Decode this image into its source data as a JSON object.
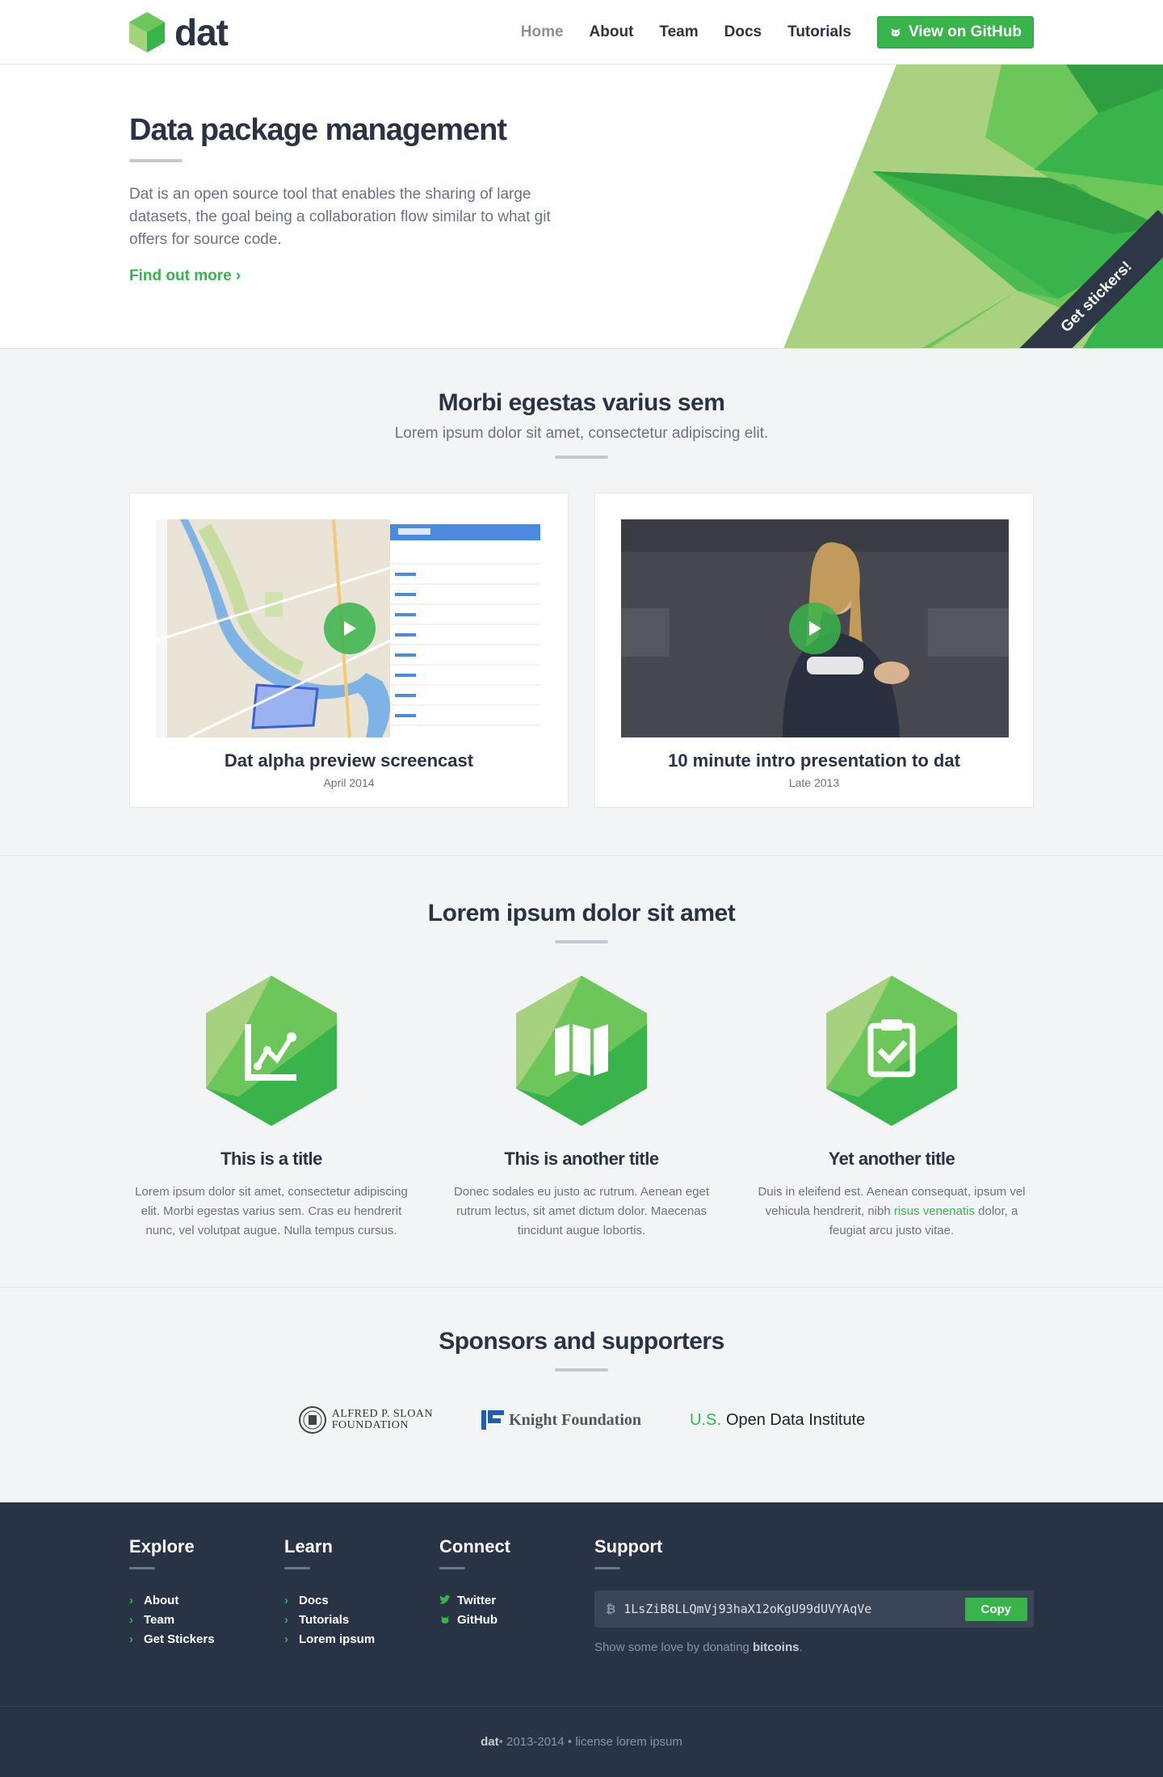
{
  "header": {
    "logo_text": "dat",
    "nav": [
      {
        "label": "Home",
        "active": true
      },
      {
        "label": "About"
      },
      {
        "label": "Team"
      },
      {
        "label": "Docs"
      },
      {
        "label": "Tutorials"
      }
    ],
    "github_button": "View on GitHub",
    "github_icon": "octocat-icon"
  },
  "hero": {
    "title": "Data package management",
    "description": "Dat is an open source tool that enables the sharing of large datasets, the goal being a collaboration flow similar to what git offers for source code.",
    "cta": "Find out more ›",
    "ribbon": "Get stickers!"
  },
  "videos": {
    "title": "Morbi egestas varius sem",
    "subtitle": "Lorem ipsum dolor sit amet, consectetur adipiscing elit.",
    "cards": [
      {
        "title": "Dat alpha preview screencast",
        "date": "April 2014"
      },
      {
        "title": "10 minute intro presentation to dat",
        "date": "Late 2013"
      }
    ]
  },
  "features": {
    "title": "Lorem ipsum dolor sit amet",
    "items": [
      {
        "title": "This is a title",
        "icon": "chart-icon",
        "desc": "Lorem ipsum dolor sit amet, consectetur adipiscing elit. Morbi egestas varius sem. Cras eu hendrerit nunc, vel volutpat augue. Nulla tempus cursus."
      },
      {
        "title": "This is another title",
        "icon": "map-icon",
        "desc": "Donec sodales eu justo ac rutrum. Aenean eget rutrum lectus, sit amet dictum dolor. Maecenas tincidunt augue lobortis."
      },
      {
        "title": "Yet another title",
        "icon": "clipboard-check-icon",
        "desc_before": "Duis in eleifend est. Aenean consequat, ipsum vel vehicula hendrerit, nibh ",
        "desc_link": "risus venenatis",
        "desc_after": " dolor, a feugiat arcu justo vitae."
      }
    ]
  },
  "sponsors": {
    "title": "Sponsors and supporters",
    "sloan_line1": "ALFRED P. SLOAN",
    "sloan_line2": "FOUNDATION",
    "knight": "Knight Foundation",
    "odi_us": "U.S.",
    "odi_name": "Open Data Institute"
  },
  "footer": {
    "explore": {
      "title": "Explore",
      "links": [
        "About",
        "Team",
        "Get Stickers"
      ]
    },
    "learn": {
      "title": "Learn",
      "links": [
        "Docs",
        "Tutorials",
        "Lorem ipsum"
      ]
    },
    "connect": {
      "title": "Connect",
      "links": [
        "Twitter",
        "GitHub"
      ]
    },
    "support": {
      "title": "Support",
      "address": "1LsZiB8LLQmVj93haX12oKgU99dUVYAqVe",
      "copy": "Copy",
      "donate_text": "Show some love by donating ",
      "donate_link": "bitcoins",
      "donate_end": "."
    },
    "bottom_brand": "dat",
    "bottom_text": " • 2013-2014 • license lorem ipsum"
  },
  "colors": {
    "accent": "#38b44a",
    "dark": "#283345",
    "text": "#2a3344"
  }
}
